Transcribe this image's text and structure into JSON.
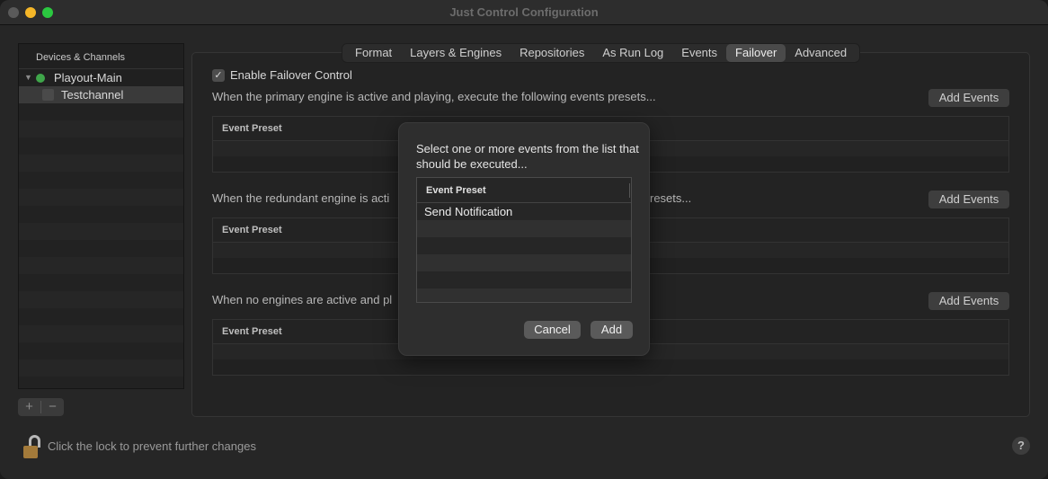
{
  "window": {
    "title": "Just Control Configuration"
  },
  "sidebar": {
    "header": "Devices & Channels",
    "items": [
      {
        "label": "Playout-Main",
        "status_color": "#3fa64a"
      },
      {
        "label": "Testchannel"
      }
    ],
    "add_label": "+",
    "remove_label": "−"
  },
  "tabs": [
    "Format",
    "Layers & Engines",
    "Repositories",
    "As Run Log",
    "Events",
    "Failover",
    "Advanced"
  ],
  "active_tab": "Failover",
  "failover": {
    "enable_label": "Enable Failover Control",
    "enable_checked": true,
    "sections": [
      {
        "description": "When the primary engine is active and playing, execute the following events presets...",
        "add_label": "Add Events",
        "column": "Event Preset"
      },
      {
        "description_left": "When the redundant engine is acti",
        "description_right": "resets...",
        "add_label": "Add Events",
        "column": "Event Preset"
      },
      {
        "description": "When no engines are active and pl",
        "add_label": "Add Events",
        "column": "Event Preset"
      }
    ]
  },
  "lock": {
    "text": "Click the lock to prevent further changes",
    "icon": "unlocked-padlock-icon"
  },
  "help": {
    "label": "?"
  },
  "dialog": {
    "message": "Select one or more events from the list that should be executed...",
    "column": "Event Preset",
    "rows": [
      "Send Notification"
    ],
    "cancel_label": "Cancel",
    "add_label": "Add"
  }
}
